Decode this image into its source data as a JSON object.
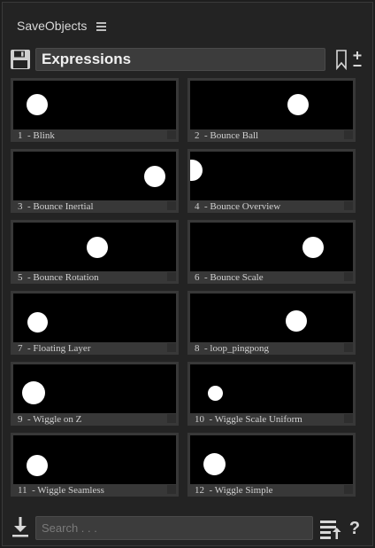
{
  "panel": {
    "title": "SaveObjects",
    "menu_icon": "hamburger-menu-icon"
  },
  "toolbar": {
    "save_icon": "floppy-disk-icon",
    "collection_name": "Expressions",
    "bookmark_icon": "bookmark-icon",
    "add_remove_icon": "plus-minus-icon"
  },
  "presets": [
    {
      "label": "1  - Blink"
    },
    {
      "label": "2  - Bounce Ball"
    },
    {
      "label": "3  - Bounce Inertial"
    },
    {
      "label": "4  - Bounce Overview"
    },
    {
      "label": "5  - Bounce Rotation"
    },
    {
      "label": "6  - Bounce Scale"
    },
    {
      "label": "7  - Floating Layer"
    },
    {
      "label": "8  - loop_pingpong"
    },
    {
      "label": "9  - Wiggle on Z"
    },
    {
      "label": "10  - Wiggle Scale Uniform"
    },
    {
      "label": "11  - Wiggle Seamless"
    },
    {
      "label": "12  - Wiggle Simple"
    }
  ],
  "footer": {
    "import_icon": "download-arrow-icon",
    "search_placeholder": "Search . . .",
    "search_value": "",
    "list_export_icon": "list-upload-icon",
    "help_label": "?"
  },
  "colors": {
    "background": "#232323",
    "thumbnail": "#000000",
    "tile_frame": "#383838",
    "text": "#d0d0d0"
  }
}
